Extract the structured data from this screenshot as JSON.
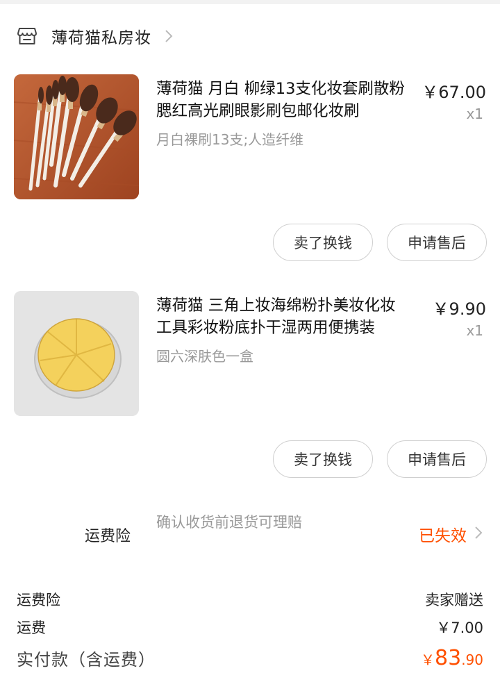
{
  "shop": {
    "name": "薄荷猫私房妆",
    "icon": "store-icon",
    "arrow_icon": "chevron-right-icon"
  },
  "products": [
    {
      "title": "薄荷猫 月白 柳绿13支化妆套刷散粉腮红高光刷眼影刷包邮化妆刷",
      "price": "￥67.00",
      "qty": "x1",
      "sku": "月白裸刷13支;人造纤维",
      "image": "makeup-brush-set-image",
      "buttons": {
        "sell": "卖了换钱",
        "aftersale": "申请售后"
      }
    },
    {
      "title": "薄荷猫 三角上妆海绵粉扑美妆化妆工具彩妆粉底扑干湿两用便携装",
      "price": "￥9.90",
      "qty": "x1",
      "sku": "圆六深肤色一盒",
      "image": "triangle-sponge-puff-image",
      "buttons": {
        "sell": "卖了换钱",
        "aftersale": "申请售后"
      }
    }
  ],
  "insurance": {
    "label": "运费险",
    "desc": "确认收货前退货可理赔",
    "status": "已失效",
    "status_color": "#ff5000"
  },
  "summary": {
    "insurance_label": "运费险",
    "insurance_value": "卖家赠送",
    "shipping_label": "运费",
    "shipping_value": "￥7.00",
    "total_label": "实付款（含运费）",
    "total_currency": "￥",
    "total_int": "83",
    "total_dec": ".90"
  },
  "colors": {
    "accent": "#ff5000",
    "muted": "#999999",
    "border": "#cfcfcf"
  }
}
